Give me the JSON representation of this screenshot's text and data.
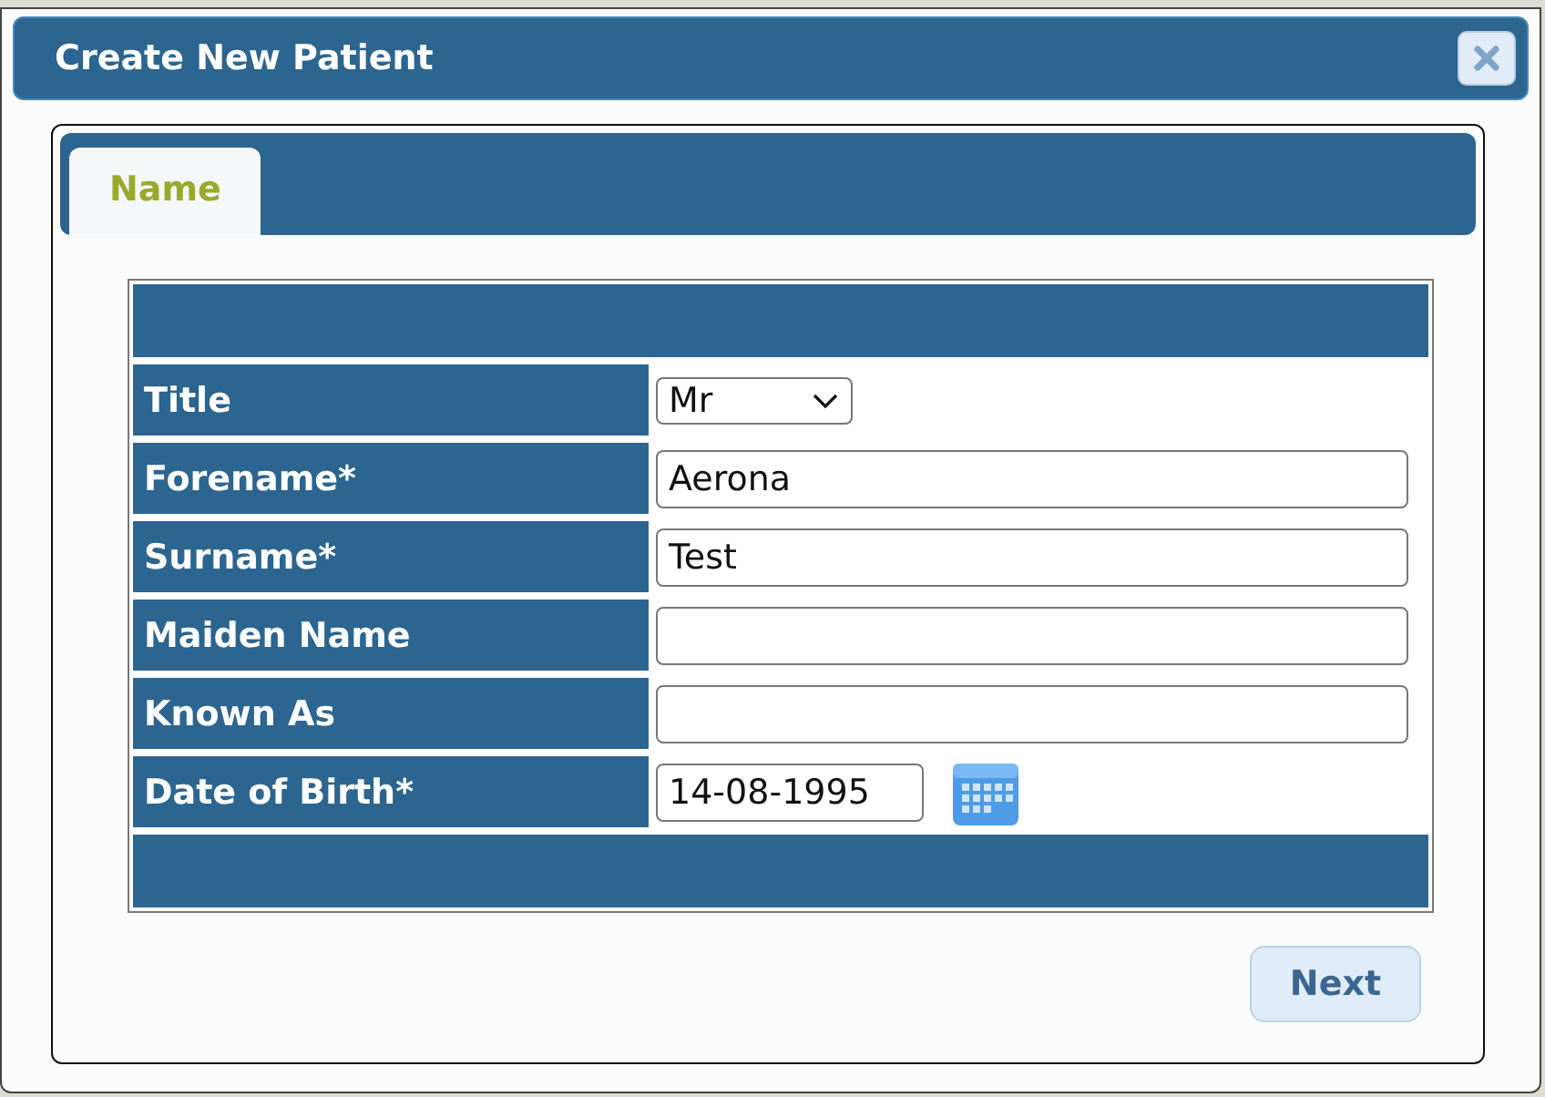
{
  "dialog": {
    "title": "Create New Patient"
  },
  "tabs": [
    {
      "label": "Name",
      "selected": true
    }
  ],
  "fields": [
    {
      "label": "Title",
      "kind": "select",
      "value": "Mr"
    },
    {
      "label": "Forename*",
      "kind": "text",
      "value": "Aerona"
    },
    {
      "label": "Surname*",
      "kind": "text",
      "value": "Test"
    },
    {
      "label": "Maiden Name",
      "kind": "text"
    },
    {
      "label": "Known As",
      "kind": "text"
    },
    {
      "label": "Date of Birth*",
      "kind": "date",
      "value": "14-08-1995"
    }
  ],
  "buttons": [
    {
      "label": "Next"
    }
  ]
}
